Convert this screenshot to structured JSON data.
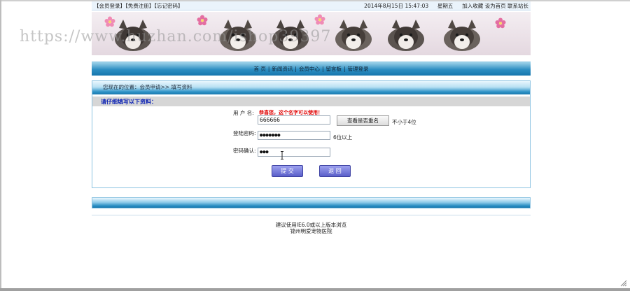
{
  "top_bar": {
    "member_login": "【会员登录】",
    "free_register": "【免费注册】",
    "forgot_password": "【忘记密码】",
    "datetime": "2014年8月15日 15:47:03",
    "weekday": "星期五",
    "add_favorite": "加入收藏",
    "set_homepage": "设为首页",
    "contact": "联系站长"
  },
  "watermark": "https://www.huzhan.com/ishop39397",
  "nav": {
    "items": [
      "首 页",
      "新闻资讯",
      "会员中心",
      "留言板",
      "管理登录"
    ],
    "separator": "|"
  },
  "breadcrumb": "您现在的位置：会员申请>> 填写资料",
  "form": {
    "heading": "请仔细填写以下资料：",
    "username_label": "用 户 名:",
    "username_message": "恭喜您，这个名字可以使用！",
    "username_value": "666666",
    "check_button": "查看是否重名",
    "username_hint": "不小于4位",
    "password_label": "登陆密码:",
    "password_value": "●●●●●●●",
    "password_hint": "6位以上",
    "confirm_label": "密码确认:",
    "confirm_value": "●●●",
    "submit_button": "提 交",
    "back_button": "返 回"
  },
  "footer": {
    "line1": "建议使用IE6.0或以上版本浏览",
    "line2": "锦州明爱宠物医院"
  },
  "colors": {
    "nav_blue": "#2d8ec2",
    "heading_blue": "#0c22b4",
    "message_red": "#e00000",
    "button_purple": "#5a5fc9"
  }
}
